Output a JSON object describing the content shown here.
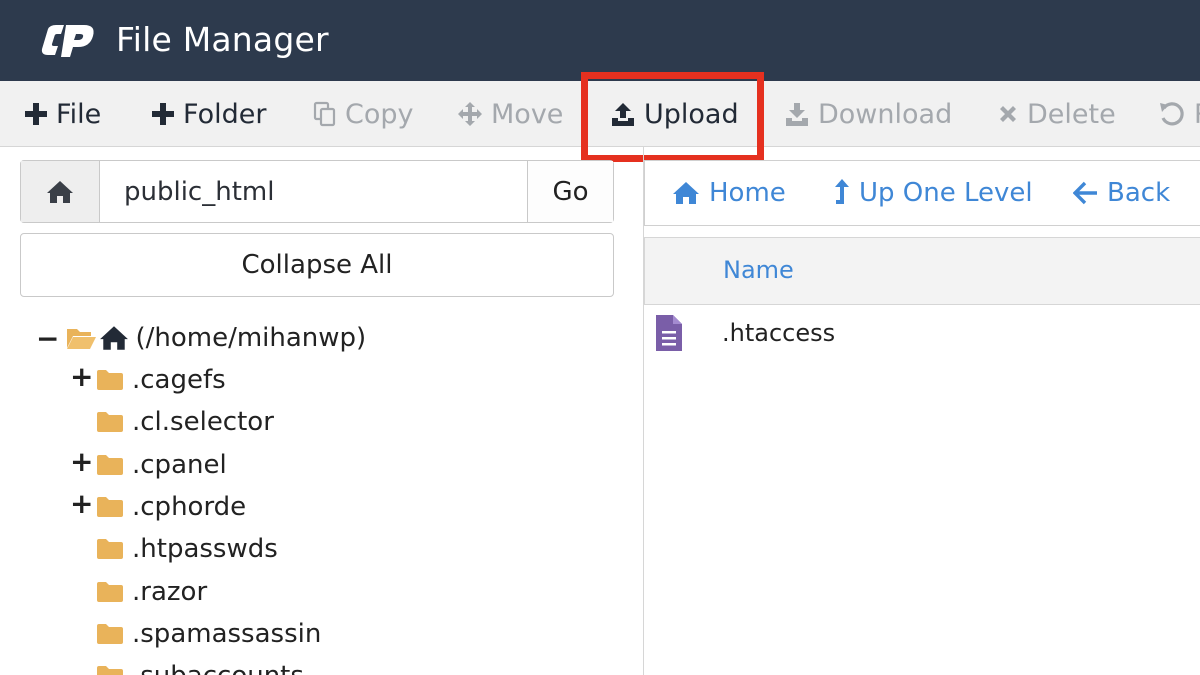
{
  "app": {
    "title": "File Manager",
    "logo_icon": "cpanel-logo-icon"
  },
  "toolbar": {
    "file": "File",
    "folder": "Folder",
    "copy": "Copy",
    "move": "Move",
    "upload": "Upload",
    "download": "Download",
    "delete": "Delete"
  },
  "path": {
    "value": "public_html",
    "go": "Go"
  },
  "collapse_all": "Collapse All",
  "tree": {
    "root": "(/home/mihanwp)",
    "items": [
      {
        "name": ".cagefs",
        "expandable": true
      },
      {
        "name": ".cl.selector",
        "expandable": false
      },
      {
        "name": ".cpanel",
        "expandable": true
      },
      {
        "name": ".cphorde",
        "expandable": true
      },
      {
        "name": ".htpasswds",
        "expandable": false
      },
      {
        "name": ".razor",
        "expandable": false
      },
      {
        "name": ".spamassassin",
        "expandable": false
      },
      {
        "name": ".subaccounts",
        "expandable": false
      }
    ]
  },
  "nav": {
    "home": "Home",
    "up": "Up One Level",
    "back": "Back"
  },
  "list": {
    "col_name": "Name",
    "files": [
      {
        "name": ".htaccess",
        "icon": "text-file-icon"
      }
    ]
  },
  "colors": {
    "header_bg": "#2d3a4d",
    "link": "#3f87d6",
    "folder": "#e9b35a",
    "highlight": "#e5301f",
    "file_icon": "#7a5ea8"
  }
}
